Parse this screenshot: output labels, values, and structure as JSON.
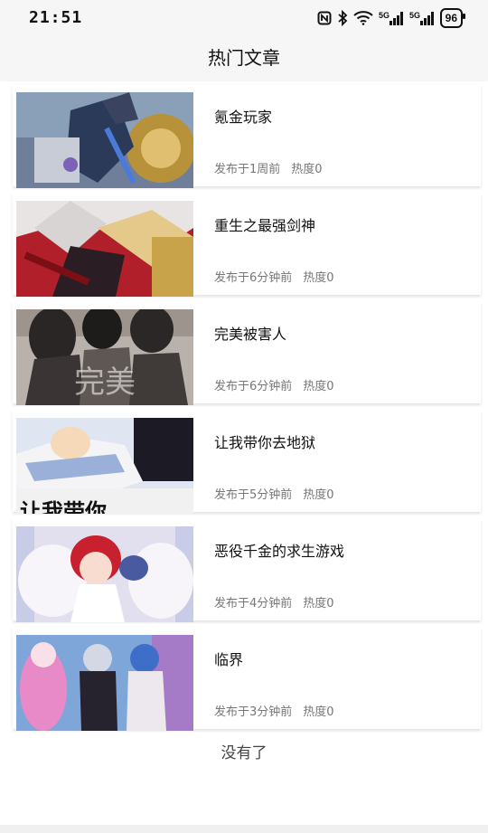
{
  "status_bar": {
    "time": "21:51",
    "battery": "96",
    "signal1": "5G",
    "signal2": "5G"
  },
  "header": {
    "title": "热门文章"
  },
  "articles": [
    {
      "title": "氪金玩家",
      "published": "发布于1周前",
      "heat": "热度0"
    },
    {
      "title": "重生之最强剑神",
      "published": "发布于6分钟前",
      "heat": "热度0"
    },
    {
      "title": "完美被害人",
      "published": "发布于6分钟前",
      "heat": "热度0",
      "cover_text": "完美"
    },
    {
      "title": "让我带你去地狱",
      "published": "发布于5分钟前",
      "heat": "热度0",
      "cover_text": "让我带你"
    },
    {
      "title": "恶役千金的求生游戏",
      "published": "发布于4分钟前",
      "heat": "热度0"
    },
    {
      "title": "临界",
      "published": "发布于3分钟前",
      "heat": "热度0"
    }
  ],
  "footer": {
    "no_more": "没有了"
  }
}
